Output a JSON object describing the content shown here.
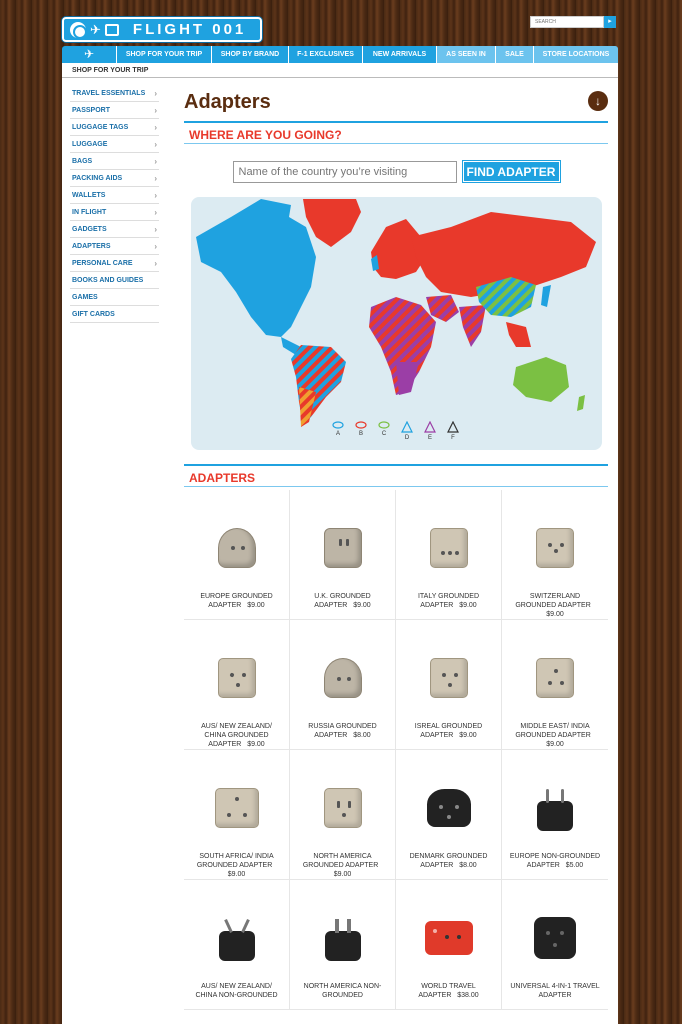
{
  "logo": {
    "text": "FLIGHT 001"
  },
  "search": {
    "placeholder": "SEARCH",
    "button_icon": "chevron-right-icon"
  },
  "nav": {
    "items": [
      "SHOP FOR YOUR TRIP",
      "SHOP BY BRAND",
      "F-1 EXCLUSIVES",
      "NEW ARRIVALS",
      "AS SEEN IN",
      "SALE",
      "STORE LOCATIONS"
    ]
  },
  "breadcrumb": "SHOP FOR YOUR TRIP",
  "sidebar": {
    "items": [
      "TRAVEL ESSENTIALS",
      "PASSPORT",
      "LUGGAGE TAGS",
      "LUGGAGE",
      "BAGS",
      "PACKING AIDS",
      "WALLETS",
      "IN FLIGHT",
      "GADGETS",
      "ADAPTERS",
      "PERSONAL CARE",
      "BOOKS AND GUIDES",
      "GAMES",
      "GIFT CARDS"
    ],
    "chevron": "›"
  },
  "page_title": "Adapters",
  "where_heading": "WHERE ARE YOU GOING?",
  "finder": {
    "placeholder": "Name of the country you’re visiting",
    "button": "FIND ADAPTER"
  },
  "map": {
    "legend": [
      "A",
      "B",
      "C",
      "D",
      "E",
      "F"
    ],
    "legend_colors": [
      "#1fa2e0",
      "#e8392b",
      "#7bc043",
      "#1fa2e0",
      "#9b3ea6",
      "#333333"
    ],
    "ocean_color": "#dcebf2"
  },
  "adapters_heading": "ADAPTERS",
  "products": [
    {
      "name": "EUROPE GROUNDED ADAPTER",
      "price": "$9.00"
    },
    {
      "name": "U.K. GROUNDED ADAPTER",
      "price": "$9.00"
    },
    {
      "name": "ITALY GROUNDED ADAPTER",
      "price": "$9.00"
    },
    {
      "name": "SWITZERLAND GROUNDED ADAPTER",
      "price": "$9.00"
    },
    {
      "name": "AUS/ NEW ZEALAND/ CHINA GROUNDED ADAPTER",
      "price": "$9.00"
    },
    {
      "name": "RUSSIA GROUNDED ADAPTER",
      "price": "$8.00"
    },
    {
      "name": "ISREAL GROUNDED ADAPTER",
      "price": "$9.00"
    },
    {
      "name": "MIDDLE EAST/ INDIA GROUNDED ADAPTER",
      "price": "$9.00"
    },
    {
      "name": "SOUTH AFRICA/ INDIA GROUNDED ADAPTER",
      "price": "$9.00"
    },
    {
      "name": "NORTH AMERICA GROUNDED ADAPTER",
      "price": "$9.00"
    },
    {
      "name": "DENMARK GROUNDED ADAPTER",
      "price": "$8.00"
    },
    {
      "name": "EUROPE NON-GROUNDED ADAPTER",
      "price": "$5.00"
    },
    {
      "name": "AUS/ NEW ZEALAND/ CHINA NON-GROUNDED",
      "price": ""
    },
    {
      "name": "NORTH AMERICA NON-GROUNDED",
      "price": ""
    },
    {
      "name": "WORLD TRAVEL ADAPTER",
      "price": "$38.00"
    },
    {
      "name": "UNIVERSAL 4-IN-1 TRAVEL ADAPTER",
      "price": ""
    }
  ],
  "colors": {
    "brand_blue": "#1fa2e0",
    "accent_red": "#e8392b",
    "title_brown": "#5a2d10"
  }
}
